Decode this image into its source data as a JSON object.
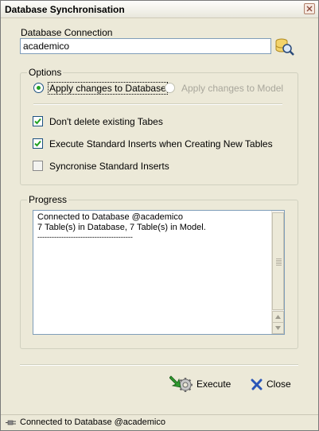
{
  "window": {
    "title": "Database Synchronisation"
  },
  "connection": {
    "label": "Database Connection",
    "value": "academico"
  },
  "options": {
    "legend": "Options",
    "radio_apply_db": "Apply changes to Database",
    "radio_apply_model": "Apply changes to Model",
    "selected": "Apply changes to Database",
    "check_dont_delete": "Don't delete existing Tabes",
    "check_execute_inserts": "Execute Standard Inserts when Creating New Tables",
    "check_sync_inserts": "Syncronise Standard Inserts"
  },
  "progress": {
    "legend": "Progress",
    "lines": [
      "Connected to Database @academico",
      "7 Table(s) in Database, 7 Table(s) in Model.",
      "----------------------------------------"
    ]
  },
  "buttons": {
    "execute": "Execute",
    "close": "Close"
  },
  "status": {
    "text": "Connected to Database @academico"
  },
  "icons": {
    "window_close": "close-icon",
    "db_search": "database-search-icon",
    "execute": "execute-gear-icon",
    "close": "close-x-icon",
    "status": "connection-plug-icon"
  }
}
